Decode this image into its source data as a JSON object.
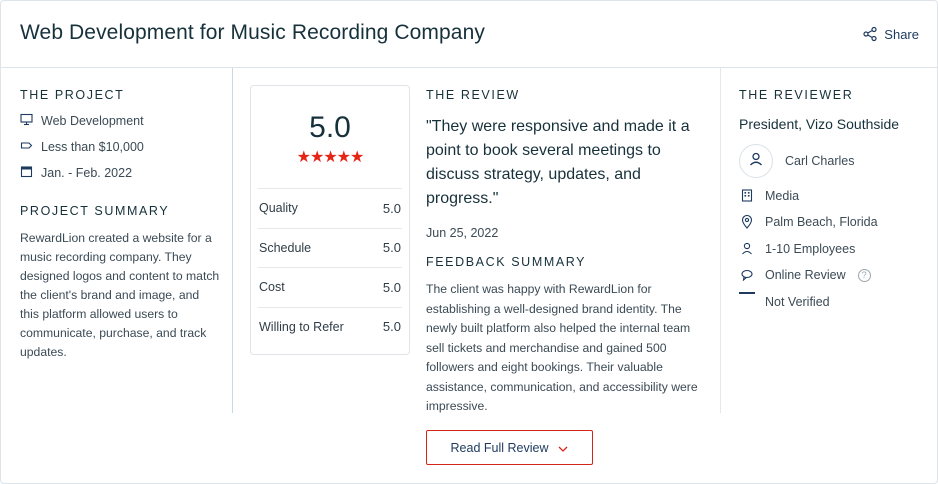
{
  "header": {
    "title": "Web Development for Music Recording Company",
    "share_label": "Share"
  },
  "project": {
    "label": "THE PROJECT",
    "items": [
      {
        "icon": "monitor-icon",
        "text": "Web Development"
      },
      {
        "icon": "price-tag-icon",
        "text": "Less than $10,000"
      },
      {
        "icon": "calendar-icon",
        "text": "Jan. - Feb. 2022"
      }
    ],
    "summary_label": "PROJECT SUMMARY",
    "summary_text": "RewardLion created a website for a music recording company. They designed logos and content to match the client's brand and image, and this platform allowed users to communicate, purchase, and track updates."
  },
  "ratings": {
    "overall": "5.0",
    "stars": "★★★★★",
    "rows": [
      {
        "label": "Quality",
        "value": "5.0"
      },
      {
        "label": "Schedule",
        "value": "5.0"
      },
      {
        "label": "Cost",
        "value": "5.0"
      },
      {
        "label": "Willing to Refer",
        "value": "5.0"
      }
    ]
  },
  "review": {
    "label": "THE REVIEW",
    "quote": "\"They were responsive and made it a point to book several meetings to discuss strategy, updates, and progress.\"",
    "date": "Jun 25, 2022",
    "feedback_label": "FEEDBACK SUMMARY",
    "feedback_text": "The client was happy with RewardLion for establishing a well-designed brand identity. The newly built platform also helped the internal team sell tickets and merchandise and gained 500 followers and eight bookings. Their valuable assistance, communication, and accessibility were impressive."
  },
  "reviewer": {
    "label": "THE REVIEWER",
    "position": "President, Vizo Southside",
    "name": "Carl Charles",
    "items": [
      {
        "icon": "building-icon",
        "text": "Media"
      },
      {
        "icon": "location-pin-icon",
        "text": "Palm Beach, Florida"
      },
      {
        "icon": "person-icon",
        "text": "1-10 Employees"
      },
      {
        "icon": "chat-bubble-icon",
        "text": "Online Review",
        "help": "?"
      },
      {
        "icon": "unverified-bar-icon",
        "text": "Not Verified"
      }
    ]
  },
  "button": {
    "label": "Read Full Review"
  },
  "colors": {
    "accent_red": "#e62415",
    "button_border": "#d3261a",
    "navy": "#1e3a5f",
    "title": "#17313b"
  }
}
